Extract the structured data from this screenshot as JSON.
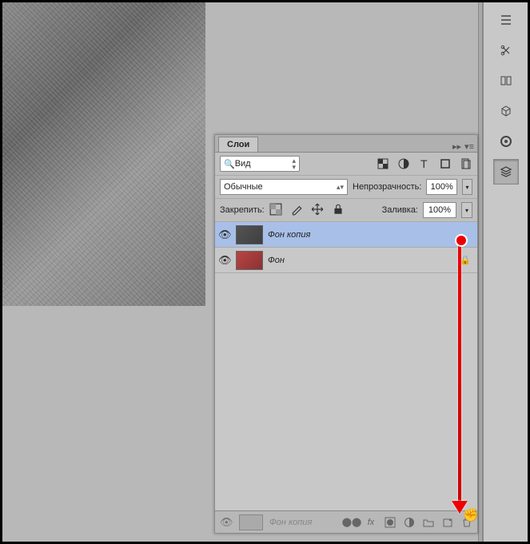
{
  "panel": {
    "title": "Слои",
    "search_label": "Вид",
    "blend_mode": "Обычные",
    "opacity_label": "Непрозрачность:",
    "opacity_value": "100%",
    "lock_label": "Закрепить:",
    "fill_label": "Заливка:",
    "fill_value": "100%"
  },
  "layers": [
    {
      "name": "Фон копия",
      "selected": true
    },
    {
      "name": "Фон",
      "selected": false,
      "locked": true
    }
  ],
  "footer": {
    "ghost_layer": "Фон копия"
  },
  "sidebar_tools": [
    "menu",
    "scissors",
    "3d-panel",
    "cube",
    "color-wheel",
    "layers"
  ]
}
